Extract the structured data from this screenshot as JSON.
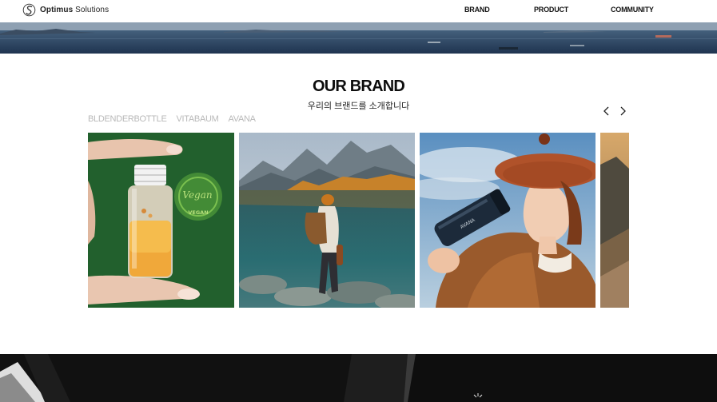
{
  "header": {
    "logo_brand": "Optimus",
    "logo_suffix": "Solutions",
    "nav": [
      {
        "label": "BRAND"
      },
      {
        "label": "PRODUCT"
      },
      {
        "label": "COMMUNITY"
      }
    ]
  },
  "brand_section": {
    "title": "OUR BRAND",
    "subtitle": "우리의 브랜드를 소개합니다",
    "tabs": [
      {
        "label": "BLDENDERBOTTLE"
      },
      {
        "label": "VITABAUM"
      },
      {
        "label": "AVANA"
      }
    ],
    "prev_icon": "chevron-left-icon",
    "next_icon": "chevron-right-icon",
    "cards": [
      {
        "name": "vegan-serum-bottle-photo",
        "badge_top": "Vegan",
        "badge_bottom": "VEGAN"
      },
      {
        "name": "lake-hiker-photo"
      },
      {
        "name": "woman-drinking-tumbler-photo",
        "tumbler_text": "AVANA"
      },
      {
        "name": "mountain-rock-photo"
      }
    ]
  },
  "colors": {
    "background": "#ffffff",
    "tab_inactive": "#b9b9b9",
    "bottom_section": "#111111"
  }
}
